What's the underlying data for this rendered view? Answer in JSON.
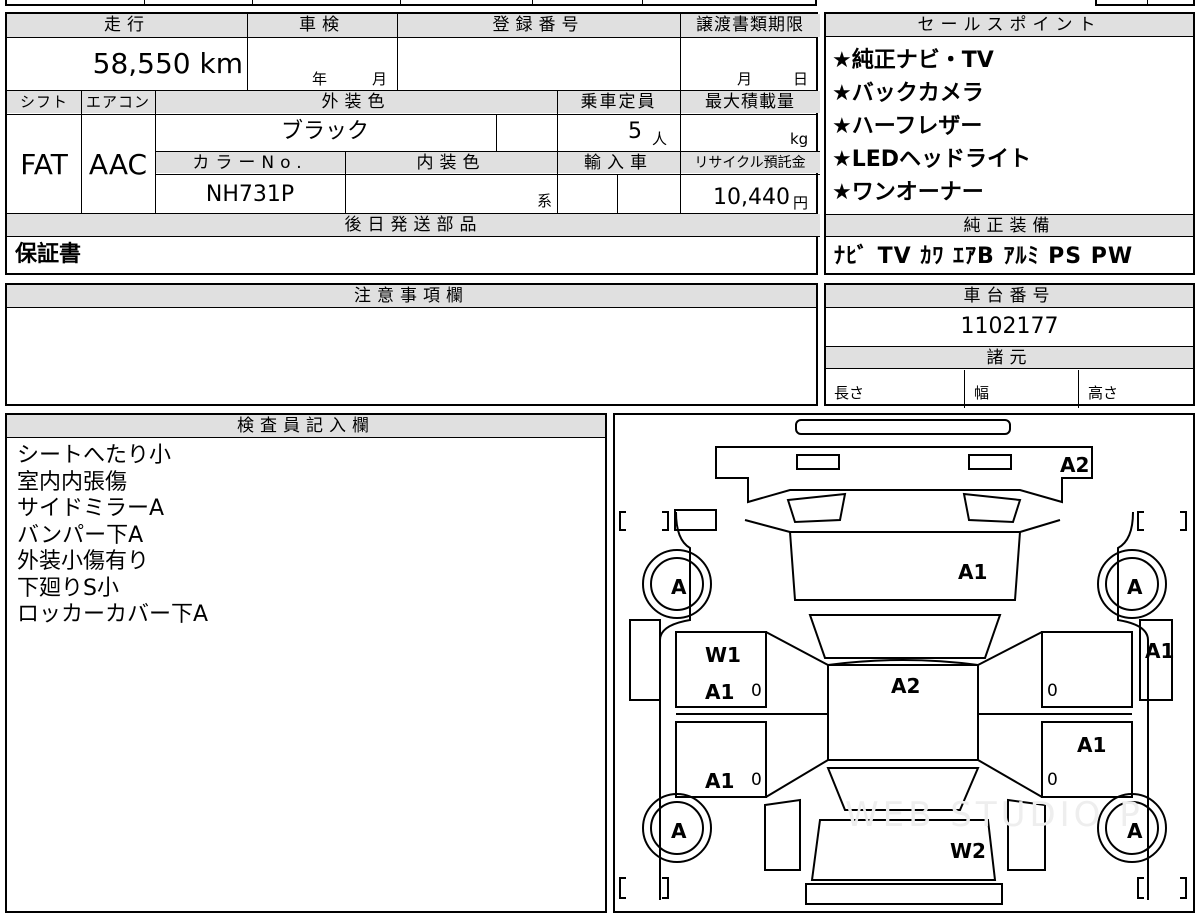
{
  "mileage": {
    "header": "走行",
    "value": "58,550 km"
  },
  "inspection": {
    "header": "車検",
    "year_unit": "年",
    "month_unit": "月"
  },
  "registration": {
    "header": "登録番号",
    "value": ""
  },
  "transfer_deadline": {
    "header": "譲渡書類期限",
    "month_unit": "月",
    "day_unit": "日"
  },
  "shift": {
    "header": "シフト",
    "value": "FAT"
  },
  "aircon": {
    "header": "エアコン",
    "value": "AAC"
  },
  "exterior_color": {
    "header": "外装色",
    "value": "ブラック"
  },
  "capacity": {
    "header": "乗車定員",
    "value": "5",
    "unit": "人"
  },
  "max_load": {
    "header": "最大積載量",
    "unit": "kg"
  },
  "color_no": {
    "header": "カラーNo.",
    "value": "NH731P"
  },
  "interior_color": {
    "header": "内装色",
    "suffix": "系"
  },
  "import": {
    "header": "輸入車"
  },
  "recycle": {
    "header": "リサイクル預託金",
    "value": "10,440",
    "unit": "円"
  },
  "later_parts": {
    "header": "後日発送部品",
    "value": "保証書"
  },
  "sales_points": {
    "header": "セールスポイント",
    "items": [
      "★純正ナビ・TV",
      "★バックカメラ",
      "★ハーフレザー",
      "★LEDヘッドライト",
      "★ワンオーナー"
    ]
  },
  "genuine_equipment": {
    "header": "純正装備",
    "value": "ﾅﾋﾞ TV ｶﾜ ｴｱB ｱﾙﾐ PS PW"
  },
  "notes": {
    "header": "注意事項欄"
  },
  "chassis_number": {
    "header": "車台番号",
    "value": "1102177"
  },
  "specs": {
    "header": "諸元",
    "length": "長さ",
    "width": "幅",
    "height": "高さ"
  },
  "inspector": {
    "header": "検査員記入欄",
    "lines": [
      "シートへたり小",
      "室内内張傷",
      "サイドミラーA",
      "バンパー下A",
      "外装小傷有り",
      "下廻りS小",
      "ロッカーカバー下A"
    ]
  },
  "diagram_marks": {
    "a2_top": "A2",
    "a1_hood": "A1",
    "a2_roof": "A2",
    "a1_right_mirror": "A1",
    "w1_left_front": "W1",
    "a1_left_front_door": "A1",
    "a1_left_rear_door": "A1",
    "a1_right_rear_door": "A1",
    "w2_rear": "W2",
    "tire_fl": "A",
    "tire_fr": "A",
    "tire_rl": "A",
    "tire_rr": "A",
    "zero": "0",
    "watermark": "WEB STUDIO P"
  }
}
